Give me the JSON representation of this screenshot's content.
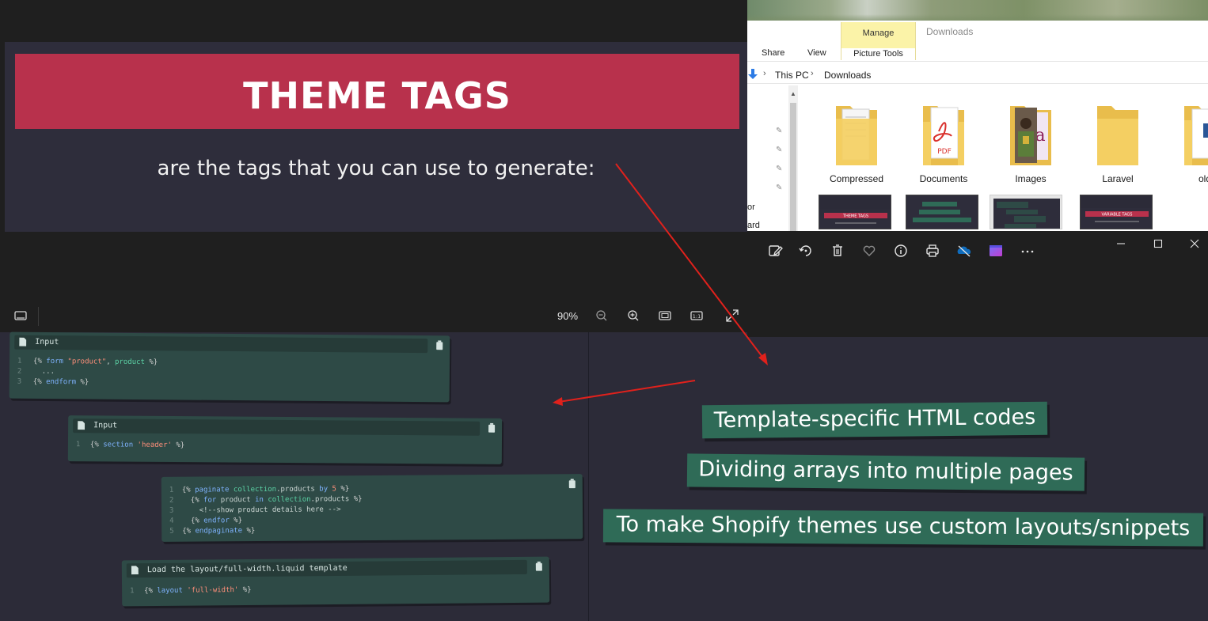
{
  "explorer": {
    "ribbon": {
      "share": "Share",
      "view": "View",
      "manage": "Manage",
      "picture_tools": "Picture Tools",
      "downloads": "Downloads"
    },
    "breadcrumb": [
      "This PC",
      "Downloads"
    ],
    "nav_fragments": [
      "or",
      "ard"
    ],
    "folders": [
      {
        "label": "Compressed",
        "kind": "zip"
      },
      {
        "label": "Documents",
        "kind": "pdf"
      },
      {
        "label": "Images",
        "kind": "photo"
      },
      {
        "label": "Laravel",
        "kind": "plain"
      },
      {
        "label": "old",
        "kind": "word"
      }
    ],
    "thumbnails": [
      {
        "title": "THEME TAGS"
      },
      {
        "title": ""
      },
      {
        "title": ""
      },
      {
        "title": "VARIABLE TAGS"
      }
    ]
  },
  "photos_toolbar": {
    "tools": [
      "edit-icon",
      "rotate-icon",
      "delete-icon",
      "favorite-icon",
      "info-icon",
      "print-icon",
      "onedrive-icon",
      "clipchamp-icon",
      "more-icon"
    ],
    "window_controls": [
      "minimize-icon",
      "maximize-icon",
      "close-icon"
    ]
  },
  "viewer": {
    "slide_title": "THEME TAGS",
    "slide_subtitle": "are the tags that you can use to generate:",
    "zoom": "90%"
  },
  "code_cards": [
    {
      "title": "Input",
      "lines": [
        {
          "n": "1",
          "html": "<span class='cmt'>{% </span><span class='kw'>form</span> <span class='str'>\"product\"</span>, <span class='var'>product</span> <span class='cmt'>%}</span>"
        },
        {
          "n": "2",
          "html": "  ..."
        },
        {
          "n": "3",
          "html": "<span class='cmt'>{% </span><span class='kw'>endform</span> <span class='cmt'>%}</span>"
        }
      ]
    },
    {
      "title": "Input",
      "lines": [
        {
          "n": "1",
          "html": "<span class='cmt'>{% </span><span class='kw'>section</span> <span class='str'>'header'</span> <span class='cmt'>%}</span>"
        }
      ]
    },
    {
      "title": "",
      "lines": [
        {
          "n": "1",
          "html": "<span class='cmt'>{% </span><span class='kw'>paginate</span> <span class='var'>collection</span>.products <span class='kw'>by</span> <span class='str'>5</span> <span class='cmt'>%}</span>"
        },
        {
          "n": "2",
          "html": "  <span class='cmt'>{% </span><span class='kw'>for</span> product <span class='kw'>in</span> <span class='var'>collection</span>.products <span class='cmt'>%}</span>"
        },
        {
          "n": "3",
          "html": "    &lt;!--show product details here --&gt;"
        },
        {
          "n": "4",
          "html": "  <span class='cmt'>{% </span><span class='kw'>endfor</span> <span class='cmt'>%}</span>"
        },
        {
          "n": "5",
          "html": "<span class='cmt'>{% </span><span class='kw'>endpaginate</span> <span class='cmt'>%}</span>"
        }
      ]
    },
    {
      "title": "Load the layout/full-width.liquid template",
      "lines": [
        {
          "n": "1",
          "html": "<span class='cmt'>{% </span><span class='kw'>layout</span> <span class='str'>'full-width'</span> <span class='cmt'>%}</span>"
        }
      ]
    }
  ],
  "banners": [
    "Template-specific HTML codes",
    "Dividing arrays into multiple pages",
    "To make Shopify themes use custom layouts/snippets"
  ],
  "colors": {
    "slide_title_bg": "#b8314c",
    "banner_bg": "#2f6b57",
    "card_bg": "#2e4a46",
    "arrow": "#e0211c",
    "manage_bg": "#fbf3a8"
  }
}
